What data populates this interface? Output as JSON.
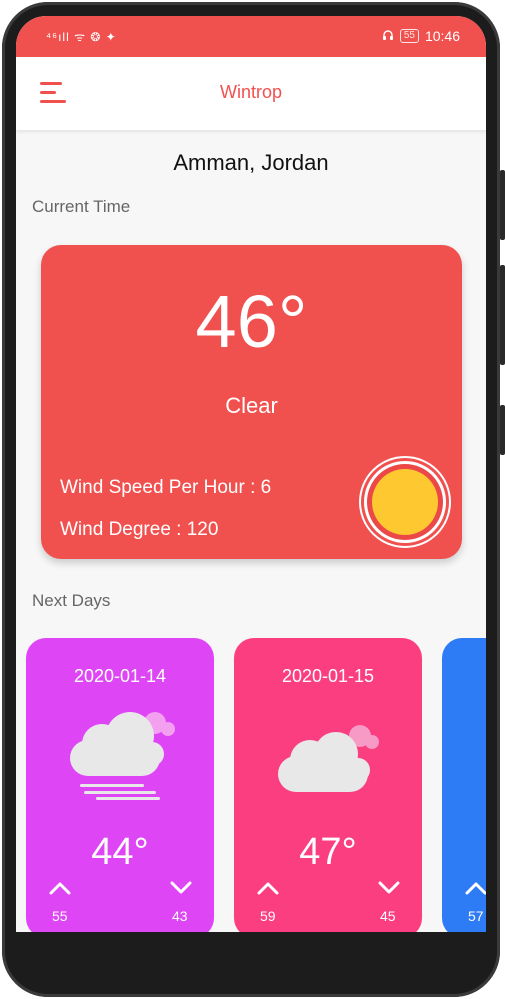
{
  "status_bar": {
    "left_icons": "⁴⁶ıll ᯤ ❂ ✦",
    "battery": "55",
    "time": "10:46"
  },
  "app": {
    "title": "Wintrop",
    "menu_icon": "hamburger-menu-icon"
  },
  "location": "Amman, Jordan",
  "current": {
    "section_label": "Current Time",
    "temperature": "46°",
    "condition": "Clear",
    "wind_speed": "Wind Speed Per Hour :  6",
    "wind_degree": "Wind Degree : 120",
    "icon": "sun-icon",
    "card_color": "#f0514f"
  },
  "next_days": {
    "section_label": "Next Days",
    "days": [
      {
        "date": "2020-01-14",
        "temp": "44°",
        "max": "55",
        "min": "43",
        "icon": "cloud-fog-icon",
        "color": "#de45f5"
      },
      {
        "date": "2020-01-15",
        "temp": "47°",
        "max": "59",
        "min": "45",
        "icon": "cloud-icon",
        "color": "#fb3e80"
      },
      {
        "date": "",
        "temp": "",
        "max": "57",
        "min": "",
        "icon": "",
        "color": "#2d7bf5"
      }
    ]
  },
  "colors": {
    "accent": "#f0514f",
    "text": "#111111",
    "muted": "#666666"
  }
}
